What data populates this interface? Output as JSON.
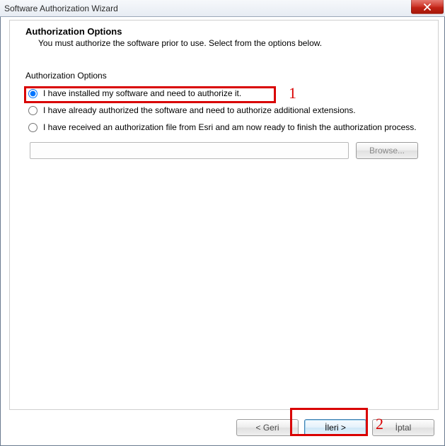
{
  "window": {
    "title": "Software Authorization Wizard"
  },
  "header": {
    "title": "Authorization Options",
    "subtitle": "You must authorize the software prior to use. Select from the options below."
  },
  "group": {
    "title": "Authorization Options",
    "option1": "I have installed my software and need to authorize it.",
    "option2": "I have already authorized the software and need to authorize additional extensions.",
    "option3": "I have received an authorization file from Esri and am now ready to finish the authorization process."
  },
  "buttons": {
    "browse": "Browse...",
    "back": "< Geri",
    "next": "İleri >",
    "cancel": "İptal"
  },
  "annotations": {
    "label1": "1",
    "label2": "2"
  }
}
